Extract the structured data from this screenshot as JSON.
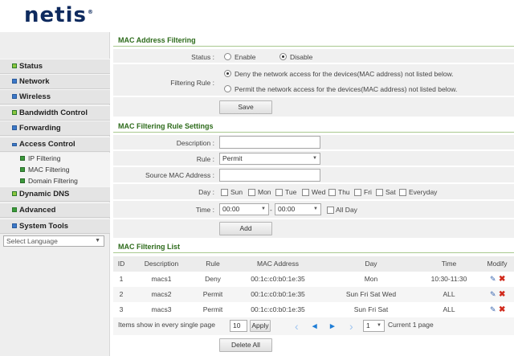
{
  "brand": {
    "logo": "netis",
    "reg": "®"
  },
  "sidebar": {
    "items": [
      {
        "label": "Status"
      },
      {
        "label": "Network"
      },
      {
        "label": "Wireless"
      },
      {
        "label": "Bandwidth Control"
      },
      {
        "label": "Forwarding"
      },
      {
        "label": "Access Control"
      },
      {
        "label": "Dynamic DNS"
      },
      {
        "label": "Advanced"
      },
      {
        "label": "System Tools"
      }
    ],
    "sub_items": [
      {
        "label": "IP Filtering"
      },
      {
        "label": "MAC Filtering"
      },
      {
        "label": "Domain Filtering"
      }
    ],
    "language": {
      "value": "Select Language"
    }
  },
  "mac_filtering": {
    "title": "MAC Address Filtering",
    "status_label": "Status :",
    "status_enable": "Enable",
    "status_disable": "Disable",
    "status_selected": "Disable",
    "rule_label": "Filtering Rule :",
    "rule_deny": "Deny the network access for the devices(MAC address) not listed below.",
    "rule_permit": "Permit the network access for the devices(MAC address) not listed below.",
    "rule_selected": "deny",
    "save_label": "Save"
  },
  "rule_settings": {
    "title": "MAC Filtering Rule Settings",
    "description_label": "Description :",
    "description_value": "",
    "rule_label": "Rule :",
    "rule_value": "Permit",
    "mac_label": "Source MAC Address :",
    "mac_value": "",
    "day_label": "Day :",
    "days": [
      "Sun",
      "Mon",
      "Tue",
      "Wed",
      "Thu",
      "Fri",
      "Sat",
      "Everyday"
    ],
    "time_label": "Time :",
    "time_start": "00:00",
    "time_separator": "-",
    "time_end": "00:00",
    "all_day": "All Day",
    "add_label": "Add"
  },
  "filter_list": {
    "title": "MAC Filtering List",
    "headers": [
      "ID",
      "Description",
      "Rule",
      "MAC Address",
      "Day",
      "Time",
      "Modify"
    ],
    "rows": [
      {
        "id": "1",
        "description": "macs1",
        "rule": "Deny",
        "mac": "00:1c:c0:b0:1e:35",
        "day": "Mon",
        "time": "10:30-11:30"
      },
      {
        "id": "2",
        "description": "macs2",
        "rule": "Permit",
        "mac": "00:1c:c0:b0:1e:35",
        "day": "Sun Fri Sat Wed",
        "time": "ALL"
      },
      {
        "id": "3",
        "description": "macs3",
        "rule": "Permit",
        "mac": "00:1c:c0:b0:1e:35",
        "day": "Sun Fri Sat",
        "time": "ALL"
      }
    ],
    "pager": {
      "items_label": "Items show in every single page",
      "items_value": "10",
      "apply_label": "Apply",
      "page_value": "1",
      "current_label": "Current 1 page"
    },
    "delete_all_label": "Delete All"
  }
}
